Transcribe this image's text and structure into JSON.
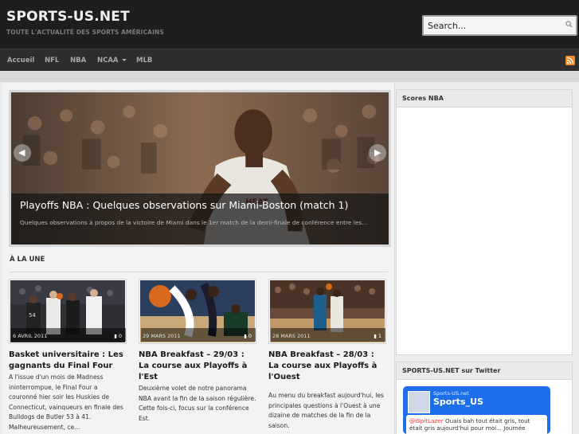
{
  "site": {
    "title": "SPORTS-US.NET",
    "tagline": "TOUTE L'ACTUALITÉ DES SPORTS AMÉRICAINS"
  },
  "search": {
    "placeholder": "Search..."
  },
  "nav": {
    "items": [
      {
        "label": "Accueil"
      },
      {
        "label": "NFL"
      },
      {
        "label": "NBA"
      },
      {
        "label": "NCAA"
      },
      {
        "label": "MLB"
      }
    ],
    "rss_icon": "rss-icon"
  },
  "slider": {
    "title": "Playoffs NBA : Quelques observations sur Miami-Boston (match 1)",
    "excerpt": "Quelques observations à propos de la victoire de Miami dans le 1er match de la demi-finale de conférence entre les..."
  },
  "section": {
    "heading": "À LA UNE"
  },
  "articles": [
    {
      "date": "6 AVRIL 2011",
      "comments": "0",
      "title": "Basket universitaire : Les gagnants du Final Four",
      "excerpt": "A l'issue d'un mois de Madness ininterrompue, le Final Four a couronné hier soir les Huskies de Connecticut, vainqueurs en finale des Bulldogs de Butler 53 à 41. Malheureusement, ce..."
    },
    {
      "date": "29 MARS 2011",
      "comments": "0",
      "title": "NBA Breakfast – 29/03 : La course aux Playoffs à l'Est",
      "excerpt": "Deuxième volet de notre panorama NBA avant la fin de la saison régulière. Cette fois-ci, focus sur la conférence Est."
    },
    {
      "date": "28 MARS 2011",
      "comments": "1",
      "title": "NBA Breakfast – 28/03 : La course aux Playoffs à l'Ouest",
      "excerpt": "Au menu du breakfast aujourd'hui, les principales questions à l'Ouest à une dizaine de matches de la fin de la saison."
    }
  ],
  "sidebar": {
    "scores_title": "Scores NBA",
    "twitter_title": "SPORTS-US.NET sur Twitter",
    "twitter": {
      "name": "Sports-US.net",
      "handle": "Sports_US",
      "tweet_mention": "@iSpitLazer",
      "tweet_text": " Ouais bah tout était gris, tout était gris aujourd'hui pour moi... Journée"
    }
  },
  "colors": {
    "header_bg": "#1e1e1e",
    "nav_bg": "#2d2d2d",
    "twitter_blue": "#1d6ee8",
    "rss_orange": "#f08a24"
  }
}
